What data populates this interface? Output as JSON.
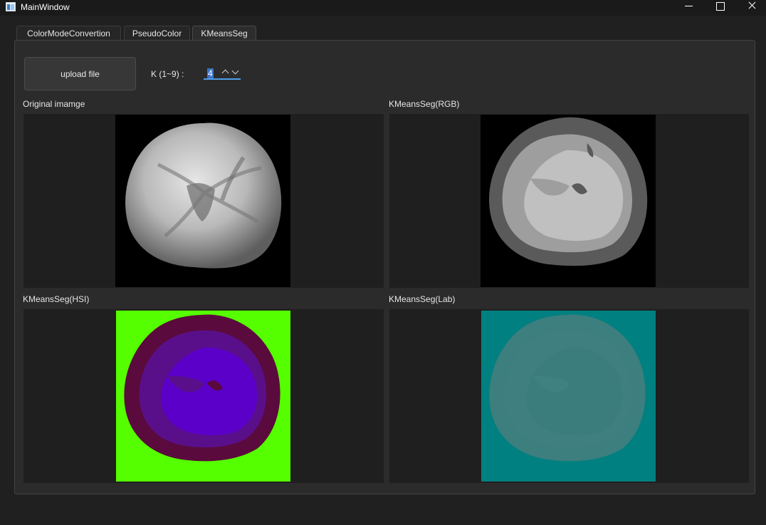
{
  "window": {
    "title": "MainWindow"
  },
  "tabs": [
    {
      "label": "ColorModeConvertion",
      "active": false
    },
    {
      "label": "PseudoColor",
      "active": false
    },
    {
      "label": "KMeansSeg",
      "active": true
    }
  ],
  "controls": {
    "upload_label": "upload file",
    "k_label": "K (1~9) :",
    "k_value": "4"
  },
  "panels": [
    {
      "label": "Original imamge",
      "image": "grayscale-fundus"
    },
    {
      "label": "KMeansSeg(RGB)",
      "image": "kmeans-rgb-gray"
    },
    {
      "label": "KMeansSeg(HSI)",
      "image": "kmeans-hsi-purple"
    },
    {
      "label": "KMeansSeg(Lab)",
      "image": "kmeans-lab-teal"
    }
  ],
  "colors": {
    "accent": "#4f9de8",
    "hsi_background": "#55ff00",
    "hsi_outer": "#5a0a3c",
    "hsi_mid": "#5a0f8a",
    "hsi_inner": "#5a00c8",
    "lab_background": "#008080",
    "lab_region": "#3d7e7e"
  }
}
